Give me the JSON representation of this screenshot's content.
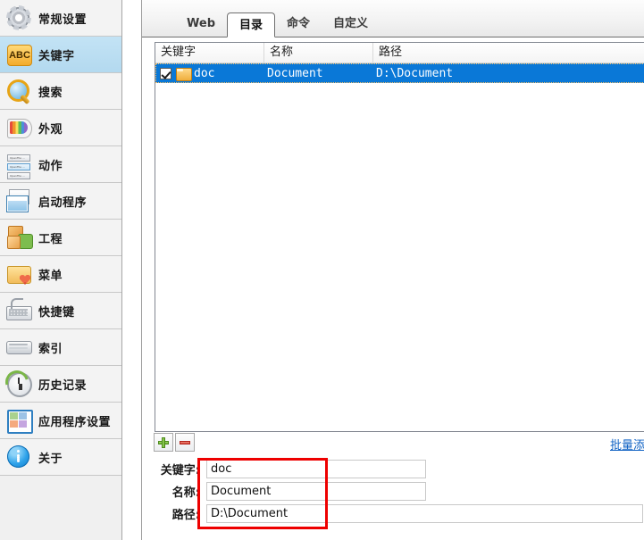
{
  "sidebar": {
    "items": [
      {
        "label": "常规设置",
        "icon": "gear-icon",
        "selected": false
      },
      {
        "label": "关键字",
        "icon": "abc-icon",
        "selected": true
      },
      {
        "label": "搜索",
        "icon": "magnifier-icon",
        "selected": false
      },
      {
        "label": "外观",
        "icon": "palette-icon",
        "selected": false
      },
      {
        "label": "动作",
        "icon": "action-list-icon",
        "selected": false
      },
      {
        "label": "启动程序",
        "icon": "windows-icon",
        "selected": false
      },
      {
        "label": "工程",
        "icon": "blocks-icon",
        "selected": false
      },
      {
        "label": "菜单",
        "icon": "folder-heart-icon",
        "selected": false
      },
      {
        "label": "快捷键",
        "icon": "keyboard-icon",
        "selected": false
      },
      {
        "label": "索引",
        "icon": "drive-icon",
        "selected": false
      },
      {
        "label": "历史记录",
        "icon": "clock-refresh-icon",
        "selected": false
      },
      {
        "label": "应用程序设置",
        "icon": "app-settings-icon",
        "selected": false
      },
      {
        "label": "关于",
        "icon": "info-icon",
        "selected": false
      }
    ]
  },
  "tabs": [
    {
      "label": "Web",
      "active": false
    },
    {
      "label": "目录",
      "active": true
    },
    {
      "label": "命令",
      "active": false
    },
    {
      "label": "自定义",
      "active": false
    }
  ],
  "list": {
    "columns": [
      "关键字",
      "名称",
      "路径"
    ],
    "rows": [
      {
        "checked": true,
        "icon": "folder-icon",
        "keyword": "doc",
        "name": "Document",
        "path": "D:\\Document",
        "selected": true
      }
    ]
  },
  "toolbar": {
    "add_label": "+",
    "remove_label": "-",
    "bulk_link": "批量添"
  },
  "form": {
    "fields": [
      {
        "label": "关键字:",
        "value": "doc",
        "placeholder": ""
      },
      {
        "label": "名称:",
        "value": "Document",
        "placeholder": ""
      },
      {
        "label": "路径:",
        "value": "D:\\Document",
        "placeholder": ""
      }
    ]
  },
  "colors": {
    "selection_blue": "#0a78d7",
    "sidebar_selected": "#bcdff3",
    "link_blue": "#1163c4",
    "annotation_red": "#ee0000"
  }
}
